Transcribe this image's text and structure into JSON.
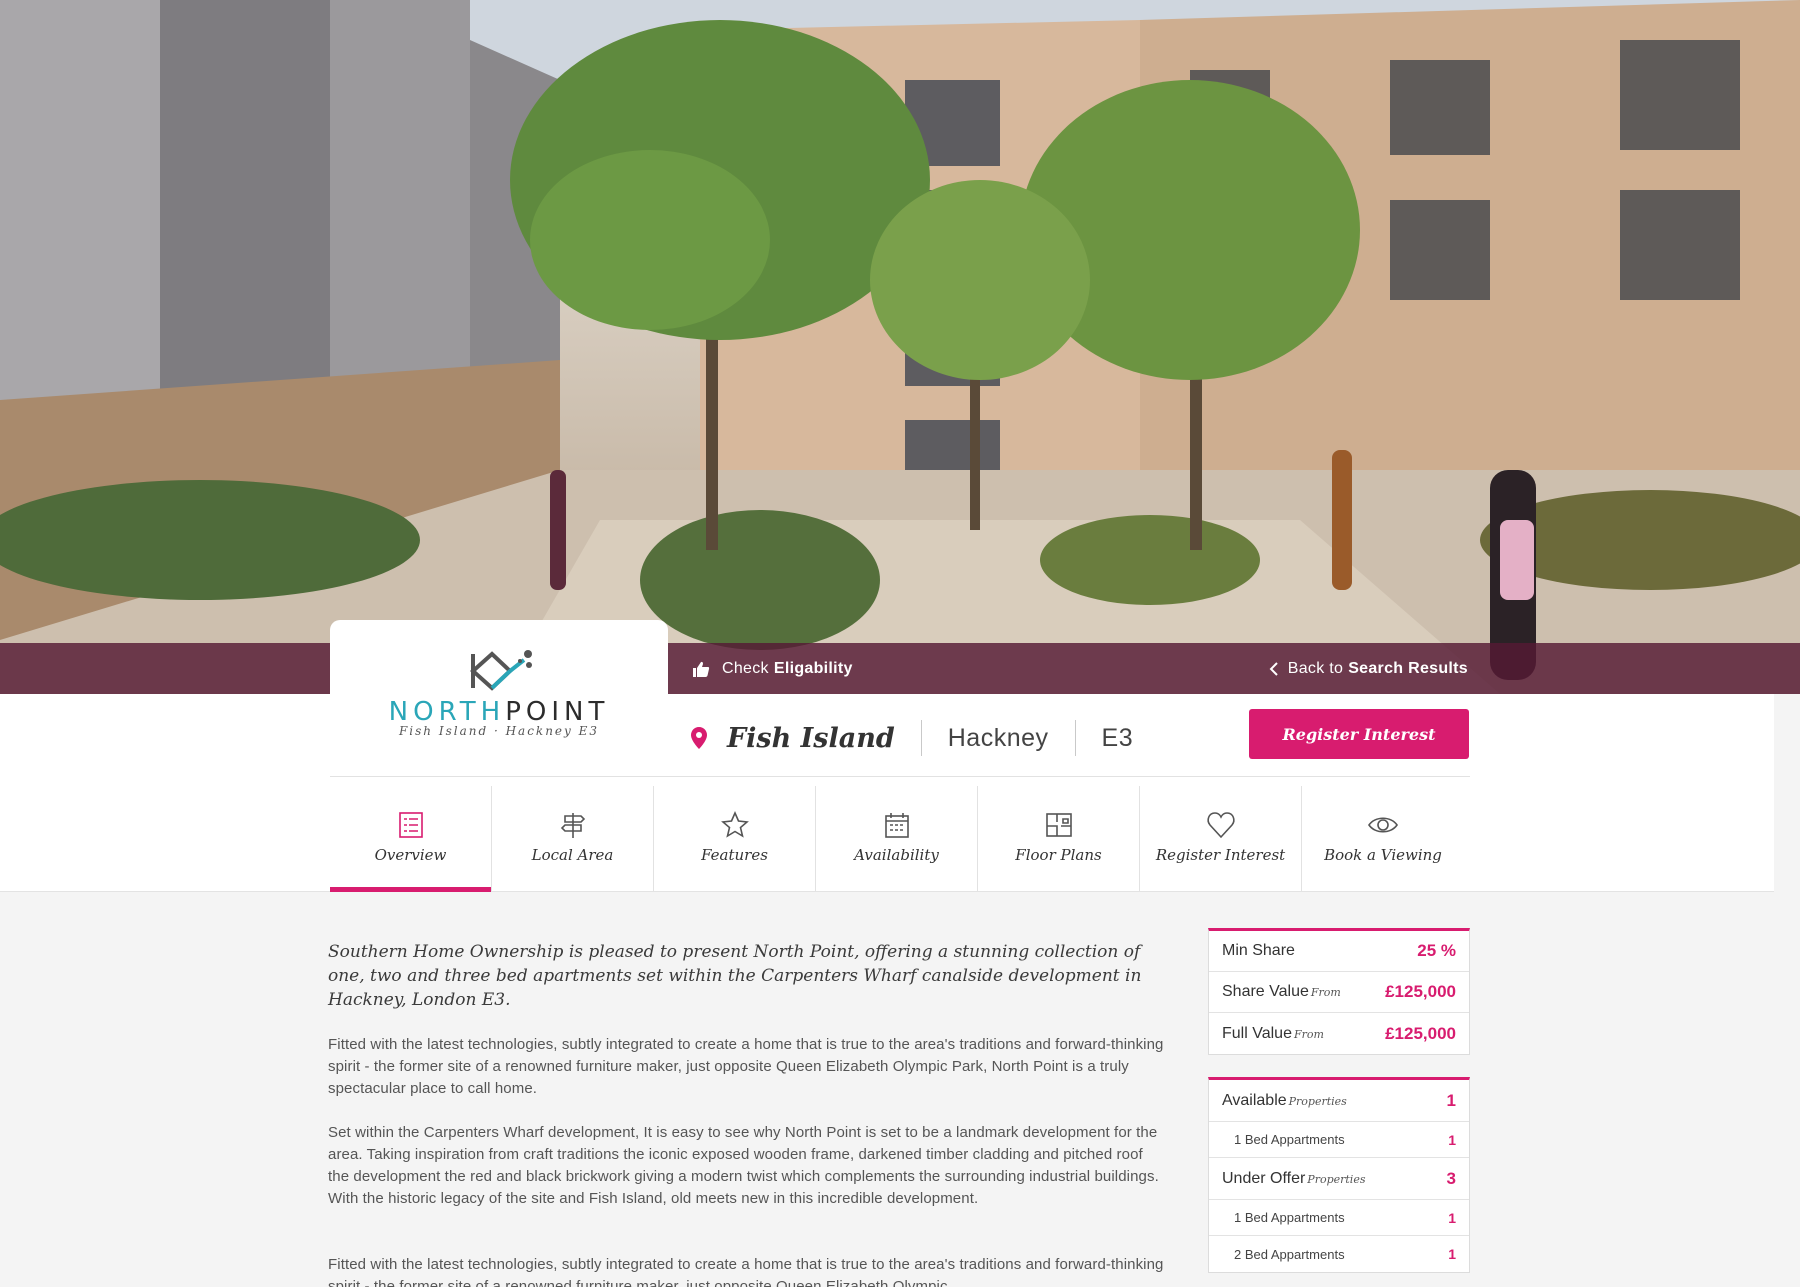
{
  "hero_bar": {
    "check_prefix": "Check",
    "check_bold": "Eligability",
    "back_prefix": "Back to",
    "back_bold": "Search Results"
  },
  "logo": {
    "name_part1": "NORTH",
    "name_part2": "POINT",
    "tagline": "Fish Island · Hackney E3"
  },
  "location": {
    "town": "Fish Island",
    "borough": "Hackney",
    "postcode": "E3"
  },
  "register_button": "Register Interest",
  "tabs": [
    {
      "label": "Overview",
      "icon": "list-icon"
    },
    {
      "label": "Local Area",
      "icon": "signpost-icon"
    },
    {
      "label": "Features",
      "icon": "star-icon"
    },
    {
      "label": "Availability",
      "icon": "calendar-icon"
    },
    {
      "label": "Floor Plans",
      "icon": "floorplan-icon"
    },
    {
      "label": "Register Interest",
      "icon": "heart-icon"
    },
    {
      "label": "Book a Viewing",
      "icon": "eye-icon"
    }
  ],
  "content": {
    "intro": "Southern Home Ownership is pleased to present North Point, offering a stunning collection of one, two and three bed apartments set within the Carpenters Wharf canalside development in Hackney, London E3.",
    "para1": "Fitted with the latest technologies, subtly integrated to create a home that is true to the area's traditions and forward-thinking spirit - the former site of a renowned furniture maker, just opposite Queen Elizabeth Olympic Park, North Point is a truly spectacular place to call home.",
    "para2": "Set within the Carpenters Wharf development, It is easy to see why North Point is set to be a landmark development for the area. Taking inspiration from craft traditions the iconic exposed wooden frame, darkened timber cladding and pitched roof the development the red and black brickwork giving a modern twist which complements the surrounding industrial buildings. With the historic legacy of the site and Fish Island, old meets new in this incredible development.",
    "para3": "Fitted with the latest technologies, subtly integrated to create a home that is true to the area's traditions and forward-thinking spirit - the former site of a renowned furniture maker, just opposite Queen Elizabeth Olympic"
  },
  "prices": {
    "min_share_label": "Min Share",
    "min_share_value": "25 %",
    "share_value_label": "Share Value",
    "share_value_note": "From",
    "share_value": "£125,000",
    "full_value_label": "Full Value",
    "full_value_note": "From",
    "full_value": "£125,000"
  },
  "availability": {
    "available_label": "Available",
    "available_note": "Properties",
    "available_count": "1",
    "available_rows": [
      {
        "label": "1 Bed Appartments",
        "count": "1"
      }
    ],
    "offer_label": "Under Offer",
    "offer_note": "Properties",
    "offer_count": "3",
    "offer_rows": [
      {
        "label": "1 Bed Appartments",
        "count": "1"
      },
      {
        "label": "2 Bed Appartments",
        "count": "1"
      }
    ]
  },
  "colors": {
    "accent": "#d81c6f",
    "hero_bar": "#551a34",
    "logo_teal": "#2aa6b8"
  }
}
